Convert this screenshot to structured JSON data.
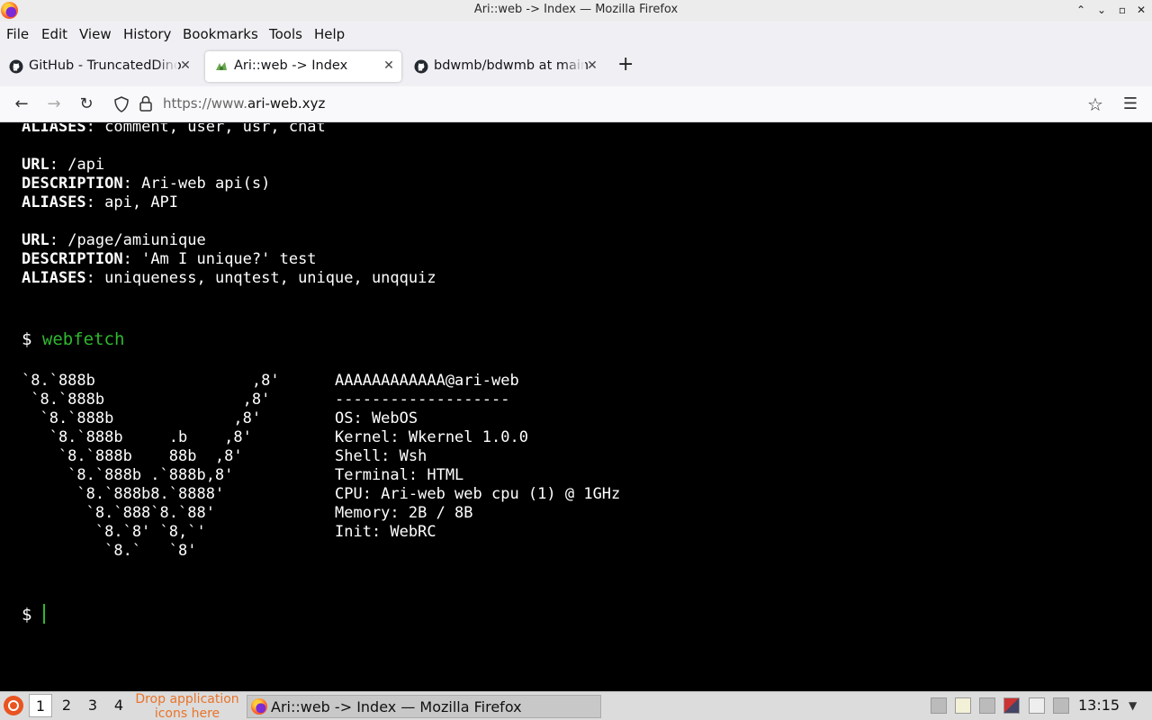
{
  "window": {
    "title": "Ari::web -> Index — Mozilla Firefox"
  },
  "menu": [
    "File",
    "Edit",
    "View",
    "History",
    "Bookmarks",
    "Tools",
    "Help"
  ],
  "tabs": [
    {
      "label": "GitHub - TruncatedDino",
      "icon": "github-icon",
      "active": false
    },
    {
      "label": "Ari::web -> Index",
      "icon": "ari-web-icon",
      "active": true
    },
    {
      "label": "bdwmb/bdwmb at main",
      "icon": "github-icon",
      "active": false
    }
  ],
  "address_bar": {
    "url_prefix": "https://www.",
    "url_domain": "ari-web.xyz"
  },
  "terminal": {
    "lines": [
      {
        "key": "ALIASES",
        "value": "comment, user, usr, chat"
      },
      {
        "key": "URL",
        "value": "/api"
      },
      {
        "key": "DESCRIPTION",
        "value": "Ari-web api(s)"
      },
      {
        "key": "ALIASES",
        "value": "api, API"
      },
      {
        "key": "URL",
        "value": "/page/amiunique"
      },
      {
        "key": "DESCRIPTION",
        "value": "'Am I unique?' test"
      },
      {
        "key": "ALIASES",
        "value": "uniqueness, unqtest, unique, unqquiz"
      }
    ],
    "prompt": "$",
    "command": "webfetch",
    "logo": [
      "`8.`888b                 ,8'",
      " `8.`888b               ,8'",
      "  `8.`888b             ,8'",
      "   `8.`888b     .b    ,8'",
      "    `8.`888b    88b  ,8'",
      "     `8.`888b .`888b,8'",
      "      `8.`888b8.`8888'",
      "       `8.`888`8.`88'",
      "        `8.`8' `8,`'",
      "         `8.`   `8'"
    ],
    "info": [
      "AAAAAAAAAAAA@ari-web",
      "-------------------",
      "OS: WebOS",
      "Kernel: Wkernel 1.0.0",
      "Shell: Wsh",
      "Terminal: HTML",
      "CPU: Ari-web web cpu (1) @ 1GHz",
      "Memory: 2B / 8B",
      "Init: WebRC"
    ],
    "prompt2": "$"
  },
  "taskbar": {
    "workspaces": [
      "1",
      "2",
      "3",
      "4"
    ],
    "current_workspace": "1",
    "drop_text_1": "Drop application",
    "drop_text_2": "icons here",
    "window_task": "Ari::web -> Index — Mozilla Firefox",
    "clock": "13:15"
  },
  "colors": {
    "prompt_green": "#2fb82f",
    "terminal_bg": "#000000",
    "drop_text": "#e8742a"
  }
}
